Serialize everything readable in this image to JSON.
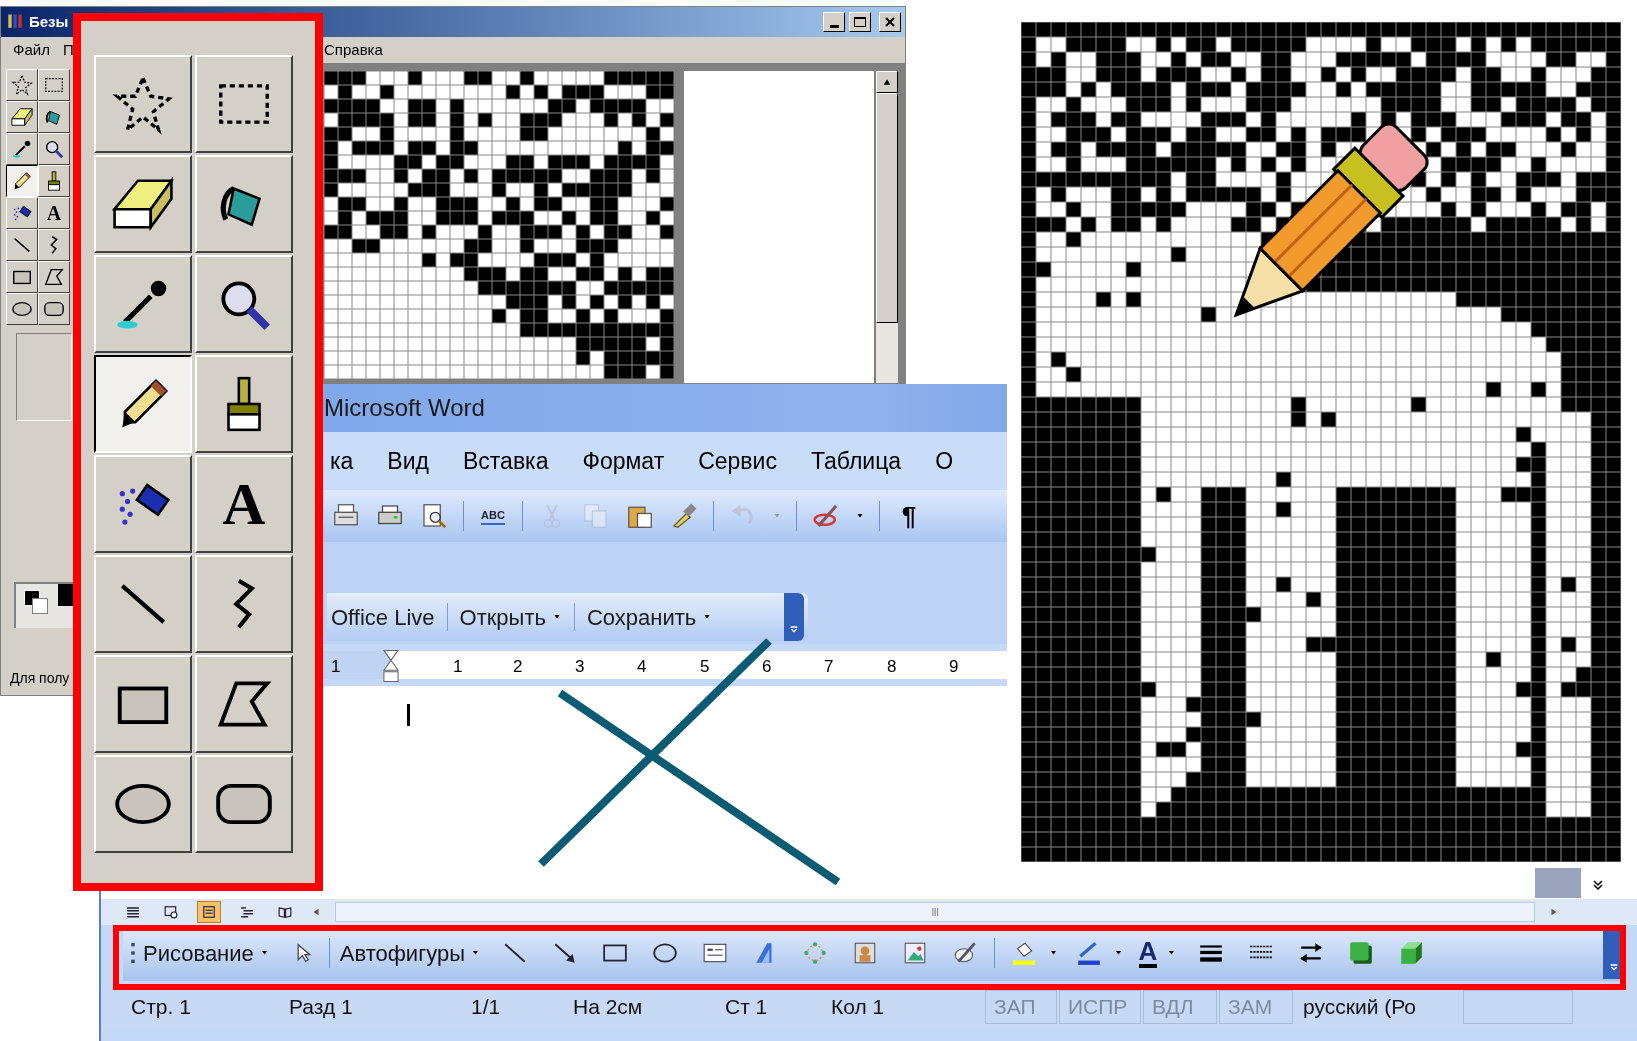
{
  "paint_window": {
    "title": "Безы",
    "menu": [
      "Файл",
      "П",
      "Справка"
    ],
    "status": "Для полу",
    "tools": [
      {
        "kind": "free-select",
        "selected": false
      },
      {
        "kind": "rect-select",
        "selected": false
      },
      {
        "kind": "eraser",
        "selected": false
      },
      {
        "kind": "fill",
        "selected": false
      },
      {
        "kind": "picker",
        "selected": false
      },
      {
        "kind": "magnifier",
        "selected": false
      },
      {
        "kind": "pencil",
        "selected": true
      },
      {
        "kind": "brush",
        "selected": false
      },
      {
        "kind": "airbrush",
        "selected": false
      },
      {
        "kind": "text",
        "glyph": "A",
        "selected": false
      },
      {
        "kind": "line",
        "selected": false
      },
      {
        "kind": "curve",
        "selected": false
      },
      {
        "kind": "rectangle",
        "selected": false
      },
      {
        "kind": "polygon",
        "selected": false
      },
      {
        "kind": "ellipse",
        "selected": false
      },
      {
        "kind": "rounded-rectangle",
        "selected": false
      }
    ]
  },
  "enlarged_toolbox": {
    "tools": [
      {
        "kind": "free-select",
        "selected": false
      },
      {
        "kind": "rect-select",
        "selected": false
      },
      {
        "kind": "eraser",
        "selected": false
      },
      {
        "kind": "fill",
        "selected": false
      },
      {
        "kind": "picker",
        "selected": false
      },
      {
        "kind": "magnifier",
        "selected": false
      },
      {
        "kind": "pencil",
        "selected": true
      },
      {
        "kind": "brush",
        "selected": false
      },
      {
        "kind": "airbrush",
        "selected": false
      },
      {
        "kind": "text",
        "glyph": "A",
        "selected": false
      },
      {
        "kind": "line",
        "selected": false
      },
      {
        "kind": "curve",
        "selected": false
      },
      {
        "kind": "rectangle",
        "selected": false
      },
      {
        "kind": "polygon",
        "selected": false
      },
      {
        "kind": "ellipse",
        "selected": false
      },
      {
        "kind": "rounded-rectangle",
        "selected": false
      }
    ]
  },
  "word_window": {
    "title": "Microsoft Word",
    "menu": [
      "ка",
      "Вид",
      "Вставка",
      "Формат",
      "Сервис",
      "Таблица",
      "О"
    ],
    "toolbar": [
      {
        "kind": "fax",
        "disabled": false
      },
      {
        "kind": "printer",
        "disabled": false
      },
      {
        "kind": "preview",
        "disabled": false
      },
      {
        "kind": "spellcheck",
        "glyph": "ABC",
        "disabled": false
      },
      {
        "kind": "cut",
        "disabled": true
      },
      {
        "kind": "copy",
        "disabled": true
      },
      {
        "kind": "paste",
        "disabled": false
      },
      {
        "kind": "format-painter",
        "disabled": false
      },
      {
        "kind": "undo",
        "disabled": true
      },
      {
        "kind": "ink",
        "disabled": false
      },
      {
        "kind": "pilcrow",
        "glyph": "¶",
        "disabled": false
      }
    ],
    "office_live_bar": [
      {
        "label": "Office Live",
        "dropdown": false
      },
      {
        "label": "Открыть",
        "dropdown": true
      },
      {
        "label": "Сохранить",
        "dropdown": true
      }
    ],
    "ruler_numbers": [
      "1",
      "1",
      "2",
      "3",
      "4",
      "5",
      "6",
      "7",
      "8",
      "9"
    ],
    "view_buttons": [
      {
        "kind": "normal",
        "selected": false
      },
      {
        "kind": "web",
        "selected": false
      },
      {
        "kind": "print",
        "selected": true
      },
      {
        "kind": "outline",
        "selected": false
      },
      {
        "kind": "reading",
        "selected": false
      }
    ],
    "drawing_toolbar": {
      "menu_label": "Рисование",
      "autoshapes_label": "Автофигуры",
      "items": [
        {
          "kind": "line"
        },
        {
          "kind": "arrow"
        },
        {
          "kind": "rectangle"
        },
        {
          "kind": "oval"
        },
        {
          "kind": "textbox"
        },
        {
          "kind": "wordart"
        },
        {
          "kind": "diagram"
        },
        {
          "kind": "clipart"
        },
        {
          "kind": "picture"
        },
        {
          "kind": "ink"
        },
        {
          "kind": "separator"
        },
        {
          "kind": "fill-color"
        },
        {
          "kind": "line-color"
        },
        {
          "kind": "font-color",
          "glyph": "A"
        },
        {
          "kind": "line-style"
        },
        {
          "kind": "dash-style"
        },
        {
          "kind": "arrow-style"
        },
        {
          "kind": "shadow"
        },
        {
          "kind": "extrusion"
        }
      ]
    },
    "scroll_grip": "III",
    "status_bar": [
      {
        "text": "Стр. 1",
        "disabled": false
      },
      {
        "text": "Разд 1",
        "disabled": false
      },
      {
        "text": "1/1",
        "disabled": false
      },
      {
        "text": "На 2см",
        "disabled": false
      },
      {
        "text": "Ст 1",
        "disabled": false
      },
      {
        "text": "Кол 1",
        "disabled": false
      },
      {
        "text": "ЗАП",
        "disabled": true
      },
      {
        "text": "ИСПР",
        "disabled": true
      },
      {
        "text": "ВДЛ",
        "disabled": true
      },
      {
        "text": "ЗАМ",
        "disabled": true
      },
      {
        "text": "русский (Ро",
        "disabled": false
      }
    ]
  }
}
